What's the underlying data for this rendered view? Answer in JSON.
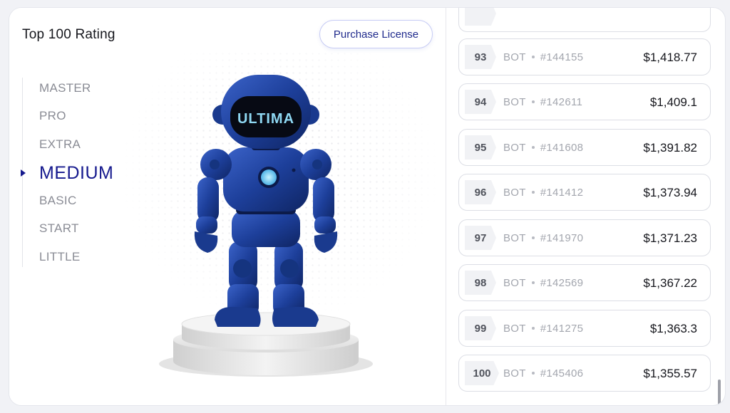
{
  "header": {
    "title": "Top 100 Rating",
    "purchase_label": "Purchase License"
  },
  "tiers": [
    {
      "label": "MASTER",
      "active": false
    },
    {
      "label": "PRO",
      "active": false
    },
    {
      "label": "EXTRA",
      "active": false
    },
    {
      "label": "MEDIUM",
      "active": true
    },
    {
      "label": "BASIC",
      "active": false
    },
    {
      "label": "START",
      "active": false
    },
    {
      "label": "LITTLE",
      "active": false
    }
  ],
  "robot": {
    "visor_text": "ULTIMA",
    "body_color": "#1d3f9a",
    "visor_color": "#070a14"
  },
  "rating_list": [
    {
      "rank": "93",
      "bot": "BOT",
      "id": "#144155",
      "price": "$1,418.77"
    },
    {
      "rank": "94",
      "bot": "BOT",
      "id": "#142611",
      "price": "$1,409.1"
    },
    {
      "rank": "95",
      "bot": "BOT",
      "id": "#141608",
      "price": "$1,391.82"
    },
    {
      "rank": "96",
      "bot": "BOT",
      "id": "#141412",
      "price": "$1,373.94"
    },
    {
      "rank": "97",
      "bot": "BOT",
      "id": "#141970",
      "price": "$1,371.23"
    },
    {
      "rank": "98",
      "bot": "BOT",
      "id": "#142569",
      "price": "$1,367.22"
    },
    {
      "rank": "99",
      "bot": "BOT",
      "id": "#141275",
      "price": "$1,363.3"
    },
    {
      "rank": "100",
      "bot": "BOT",
      "id": "#145406",
      "price": "$1,355.57"
    }
  ],
  "colors": {
    "accent": "#161a8e",
    "border": "#dcdee5"
  }
}
